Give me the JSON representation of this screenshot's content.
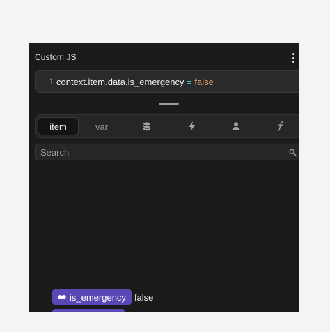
{
  "panel": {
    "title": "Custom JS"
  },
  "code": {
    "line_number": "1",
    "expression": "context.item.data.is_emergency",
    "operator": " = ",
    "value": "false"
  },
  "tabs": [
    {
      "label": "item",
      "icon": null,
      "active": true
    },
    {
      "label": "var",
      "icon": null,
      "active": false
    },
    {
      "label": "",
      "icon": "database-icon",
      "active": false
    },
    {
      "label": "",
      "icon": "lightning-icon",
      "active": false
    },
    {
      "label": "",
      "icon": "user-icon",
      "active": false
    },
    {
      "label": "",
      "icon": "function-icon",
      "active": false
    }
  ],
  "search": {
    "placeholder": "Search",
    "value": ""
  },
  "results": [
    {
      "name": "is_emergency",
      "value": "false",
      "icon": "toggle-icon"
    }
  ],
  "colors": {
    "panel_bg": "#1b1b1b",
    "chip_purple": "#5b48b6",
    "code_value_orange": "#e9a06b",
    "code_operator_teal": "#4cc2c7"
  }
}
